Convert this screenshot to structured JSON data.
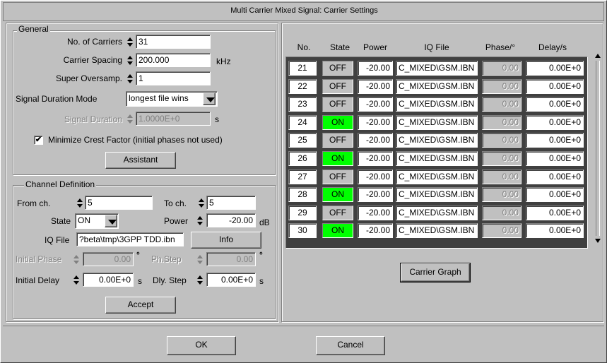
{
  "window": {
    "title": "Multi Carrier Mixed Signal: Carrier Settings"
  },
  "general": {
    "title": "General",
    "num_carriers_label": "No. of Carriers",
    "num_carriers_value": "31",
    "carrier_spacing_label": "Carrier Spacing",
    "carrier_spacing_value": "200.000",
    "carrier_spacing_unit": "kHz",
    "super_oversamp_label": "Super Oversamp.",
    "super_oversamp_value": "1",
    "signal_duration_mode_label": "Signal Duration Mode",
    "signal_duration_mode_value": "longest file wins",
    "signal_duration_label": "Signal Duration",
    "signal_duration_value": "1.0000E+0",
    "signal_duration_unit": "s",
    "minimize_crest_label": "Minimize Crest Factor (initial phases not used)",
    "minimize_crest_checked": "✔",
    "assistant_label": "Assistant"
  },
  "channel": {
    "title": "Channel Definition",
    "from_label": "From ch.",
    "from_value": "5",
    "to_label": "To ch.",
    "to_value": "5",
    "state_label": "State",
    "state_value": "ON",
    "power_label": "Power",
    "power_value": "-20.00",
    "power_unit": "dB",
    "iq_file_label": "IQ File",
    "iq_file_value": "?beta\\tmp\\3GPP TDD.ibn",
    "info_label": "Info",
    "initial_phase_label": "Initial Phase",
    "initial_phase_value": "0.00",
    "phase_unit": "°",
    "ph_step_label": "Ph.Step",
    "ph_step_value": "0.00",
    "initial_delay_label": "Initial Delay",
    "initial_delay_value": "0.00E+0",
    "delay_unit": "s",
    "dly_step_label": "Dly. Step",
    "dly_step_value": "0.00E+0",
    "accept_label": "Accept"
  },
  "table": {
    "headers": [
      "No.",
      "State",
      "Power",
      "IQ File",
      "Phase/°",
      "Delay/s"
    ],
    "rows": [
      {
        "no": "21",
        "state": "OFF",
        "power": "-20.00",
        "file": "C_MIXED\\GSM.IBN",
        "phase": "0.00",
        "delay": "0.00E+0"
      },
      {
        "no": "22",
        "state": "OFF",
        "power": "-20.00",
        "file": "C_MIXED\\GSM.IBN",
        "phase": "0.00",
        "delay": "0.00E+0"
      },
      {
        "no": "23",
        "state": "OFF",
        "power": "-20.00",
        "file": "C_MIXED\\GSM.IBN",
        "phase": "0.00",
        "delay": "0.00E+0"
      },
      {
        "no": "24",
        "state": "ON",
        "power": "-20.00",
        "file": "C_MIXED\\GSM.IBN",
        "phase": "0.00",
        "delay": "0.00E+0"
      },
      {
        "no": "25",
        "state": "OFF",
        "power": "-20.00",
        "file": "C_MIXED\\GSM.IBN",
        "phase": "0.00",
        "delay": "0.00E+0"
      },
      {
        "no": "26",
        "state": "ON",
        "power": "-20.00",
        "file": "C_MIXED\\GSM.IBN",
        "phase": "0.00",
        "delay": "0.00E+0"
      },
      {
        "no": "27",
        "state": "OFF",
        "power": "-20.00",
        "file": "C_MIXED\\GSM.IBN",
        "phase": "0.00",
        "delay": "0.00E+0"
      },
      {
        "no": "28",
        "state": "ON",
        "power": "-20.00",
        "file": "C_MIXED\\GSM.IBN",
        "phase": "0.00",
        "delay": "0.00E+0"
      },
      {
        "no": "29",
        "state": "OFF",
        "power": "-20.00",
        "file": "C_MIXED\\GSM.IBN",
        "phase": "0.00",
        "delay": "0.00E+0"
      },
      {
        "no": "30",
        "state": "ON",
        "power": "-20.00",
        "file": "C_MIXED\\GSM.IBN",
        "phase": "0.00",
        "delay": "0.00E+0"
      }
    ],
    "carrier_graph_label": "Carrier Graph"
  },
  "footer": {
    "ok_label": "OK",
    "cancel_label": "Cancel"
  },
  "colors": {
    "on_state": "#00ff00",
    "off_state": "#c0c0c0",
    "dialog_bg": "#c0c0c0"
  }
}
